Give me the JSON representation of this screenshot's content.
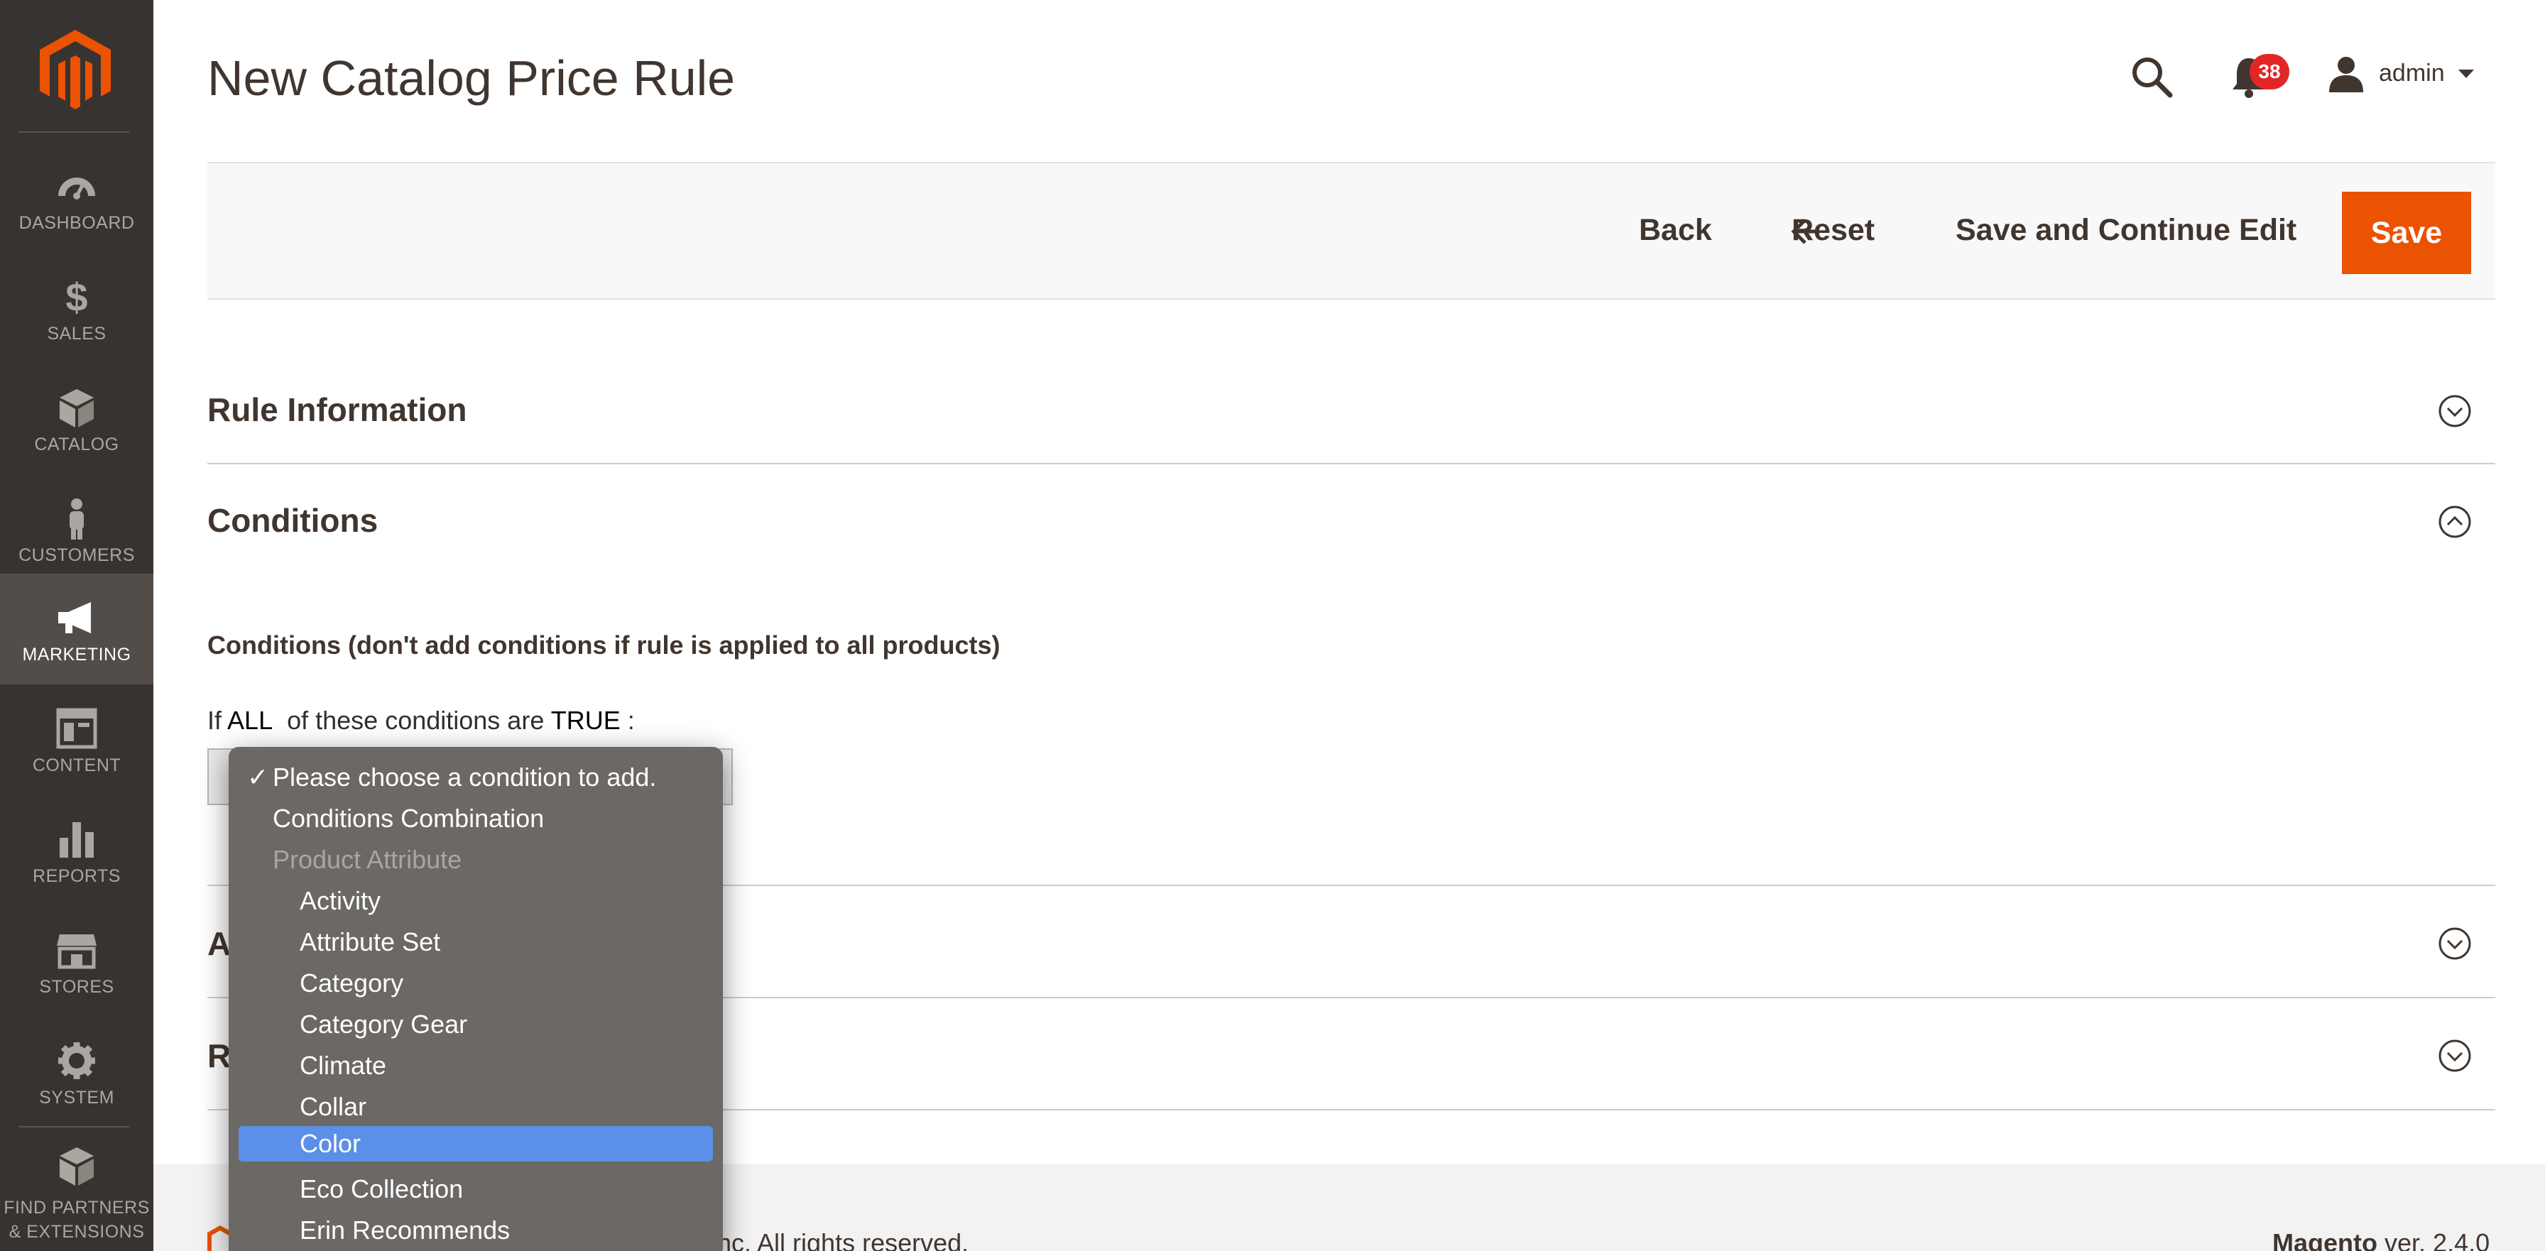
{
  "header": {
    "title": "New Catalog Price Rule",
    "notification_count": "38",
    "user": "admin"
  },
  "sidebar": {
    "items": [
      {
        "label": "DASHBOARD",
        "icon": "dashboard-icon"
      },
      {
        "label": "SALES",
        "icon": "dollar-icon"
      },
      {
        "label": "CATALOG",
        "icon": "cube-icon"
      },
      {
        "label": "CUSTOMERS",
        "icon": "person-icon"
      },
      {
        "label": "MARKETING",
        "icon": "megaphone-icon",
        "active": true
      },
      {
        "label": "CONTENT",
        "icon": "layout-icon"
      },
      {
        "label": "REPORTS",
        "icon": "bar-chart-icon"
      },
      {
        "label": "STORES",
        "icon": "store-icon"
      },
      {
        "label": "SYSTEM",
        "icon": "gear-icon"
      },
      {
        "label_line1": "FIND PARTNERS",
        "label_line2": "& EXTENSIONS",
        "icon": "box-icon"
      }
    ]
  },
  "toolbar": {
    "back": "Back",
    "reset": "Reset",
    "save_continue": "Save and Continue Edit",
    "save": "Save"
  },
  "sections": {
    "rule_information": "Rule Information",
    "conditions": "Conditions",
    "actions_partial": "A",
    "related_partial": "R"
  },
  "conditions": {
    "label": "Conditions (don't add conditions if rule is applied to all products)",
    "if_prefix": "If",
    "aggregator": "ALL",
    "middle": "of these conditions are",
    "value": "TRUE",
    "suffix": ":"
  },
  "dropdown": {
    "checkmark": "✓",
    "options": [
      {
        "label": "Please choose a condition to add.",
        "checked": true
      },
      {
        "label": "Conditions Combination"
      },
      {
        "label": "Product Attribute",
        "disabled": true
      },
      {
        "label": "Activity",
        "indent": true
      },
      {
        "label": "Attribute Set",
        "indent": true
      },
      {
        "label": "Category",
        "indent": true
      },
      {
        "label": "Category Gear",
        "indent": true
      },
      {
        "label": "Climate",
        "indent": true
      },
      {
        "label": "Collar",
        "indent": true
      },
      {
        "label": "Color",
        "indent": true,
        "highlighted": true
      },
      {
        "label": "Eco Collection",
        "indent": true
      },
      {
        "label": "Erin Recommends",
        "indent": true
      }
    ]
  },
  "footer": {
    "copyright_partial": "nc. All rights reserved.",
    "brand": "Magento",
    "version": "ver. 2.4.0"
  },
  "colors": {
    "sidebar_bg": "#373330",
    "sidebar_active": "#524d49",
    "accent": "#eb5202",
    "badge": "#e22626",
    "dropdown_bg": "#6b6866",
    "dropdown_selected": "#5b8fe8"
  }
}
